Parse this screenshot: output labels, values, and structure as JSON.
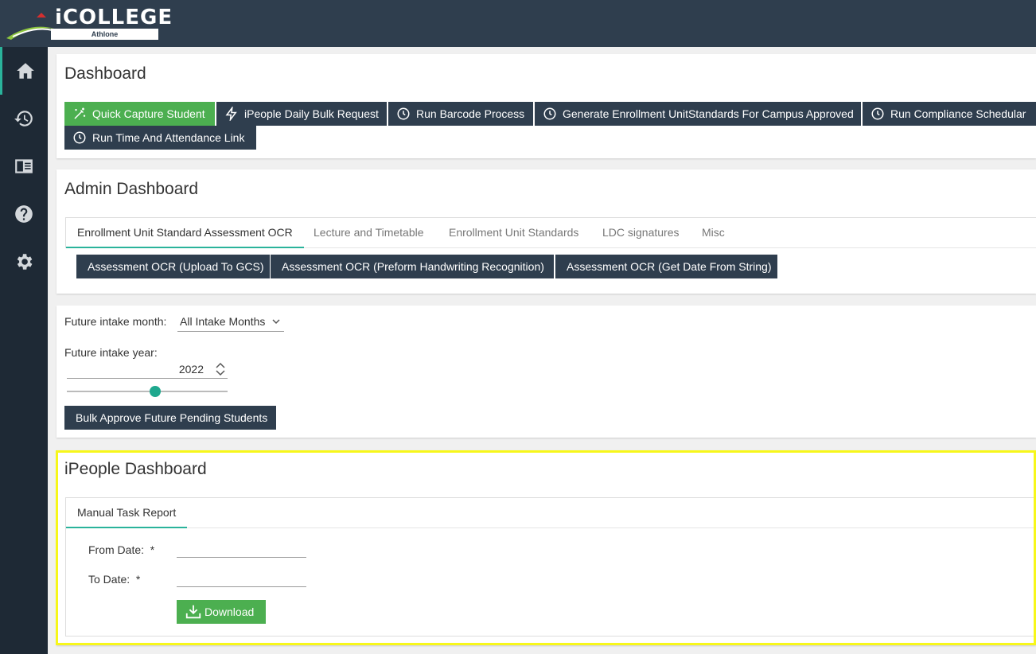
{
  "app": {
    "logo_text": "COLLEGE",
    "logo_prefix": "i",
    "logo_sub": "Athlone"
  },
  "sidebar": {
    "items": [
      "home-icon",
      "history-icon",
      "book-icon",
      "help-icon",
      "settings-icon"
    ]
  },
  "dashboard": {
    "title": "Dashboard",
    "buttons": {
      "quick_capture": "Quick Capture Student",
      "ipeople_bulk": "iPeople Daily Bulk Request",
      "barcode": "Run Barcode Process",
      "enrollment": "Generate Enrollment UnitStandards For Campus Approved",
      "compliance": "Run Compliance Schedular",
      "time_attendance": "Run Time And Attendance Link"
    }
  },
  "admin": {
    "title": "Admin Dashboard",
    "tabs": [
      "Enrollment Unit Standard Assessment OCR",
      "Lecture and Timetable",
      "Enrollment Unit Standards",
      "LDC signatures",
      "Misc"
    ],
    "buttons": {
      "upload": "Assessment OCR (Upload To GCS)",
      "handwriting": "Assessment OCR (Preform Handwriting Recognition)",
      "date": "Assessment OCR (Get Date From String)"
    }
  },
  "future": {
    "month_label": "Future intake month:",
    "month_value": "All Intake Months",
    "year_label": "Future intake year:",
    "year_value": "2022",
    "slider_value": 0.55,
    "bulk_button": "Bulk Approve Future Pending Students"
  },
  "ipeople": {
    "title": "iPeople Dashboard",
    "tab": "Manual Task Report",
    "from_label": "From Date:",
    "to_label": "To Date:",
    "required": "*",
    "from_value": "",
    "to_value": "",
    "download": "Download"
  },
  "colors": {
    "topbar": "#2f3e4e",
    "sidebar": "#1e2935",
    "accent": "#2ab39b",
    "green": "#4caf50",
    "highlight": "#f7f71a"
  }
}
